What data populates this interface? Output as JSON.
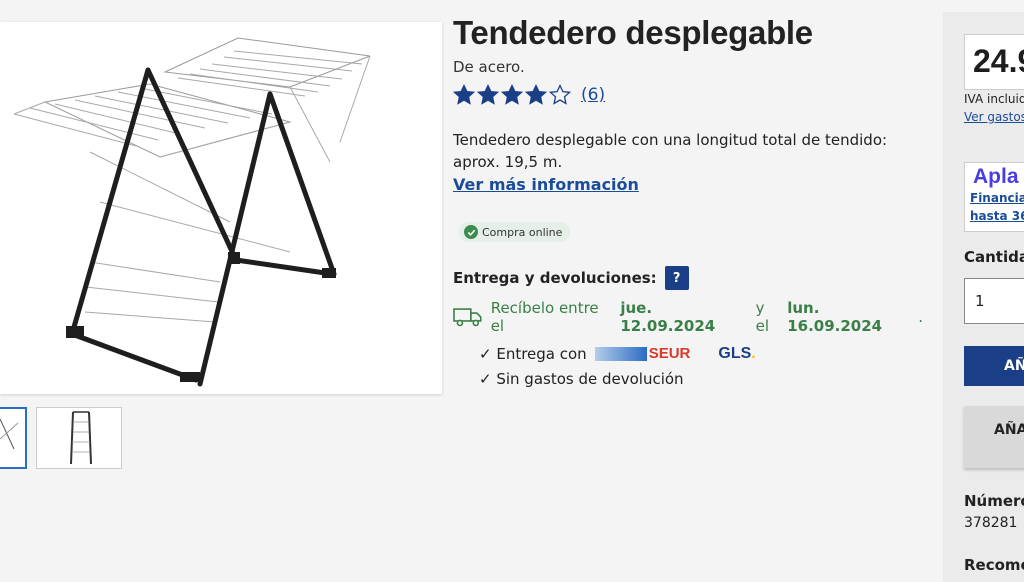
{
  "product": {
    "title": "Tendedero desplegable",
    "subtitle": "De acero.",
    "rating": 4,
    "rating_max": 5,
    "review_count": "(6)",
    "description": "Tendedero desplegable con una longitud total de tendido: aprox. 19,5 m.",
    "more_info_link": "Ver más información",
    "online_badge": "Compra online"
  },
  "delivery": {
    "heading": "Entrega y devoluciones:",
    "help_label": "?",
    "prefix": "Recíbelo entre el",
    "date_from": "jue. 12.09.2024",
    "connector": "y el",
    "date_to": "lun. 16.09.2024",
    "suffix": ".",
    "carrier_prefix": "✓ Entrega con",
    "carrier_1": "SEUR",
    "carrier_2": "GLS",
    "carrier_2_dot": ".",
    "returns": "✓ Sin gastos de devolución"
  },
  "sidebar": {
    "price": "24.9",
    "vat_note": "IVA incluid",
    "shipping_link": "Ver gastos",
    "financing_logo": "Apla",
    "financing_line1": "Financiac",
    "financing_line2": "hasta 36 ",
    "quantity_label": "Cantidad",
    "quantity_value": "1",
    "add_to_cart": "AÑA",
    "add_secondary": "AÑA",
    "item_number_label": "Número",
    "item_number": "378281",
    "recommend_label": "Recomen"
  },
  "icons": {
    "star_filled": "star-filled-icon",
    "star_empty": "star-empty-icon",
    "truck": "truck-icon",
    "check": "check-icon"
  },
  "colors": {
    "accent": "#1a3f86",
    "link": "#1a4c9a",
    "delivery_green": "#3a7f46",
    "star": "#1a3f86",
    "seur_red": "#d8392b",
    "gls_yellow": "#f2c200"
  }
}
